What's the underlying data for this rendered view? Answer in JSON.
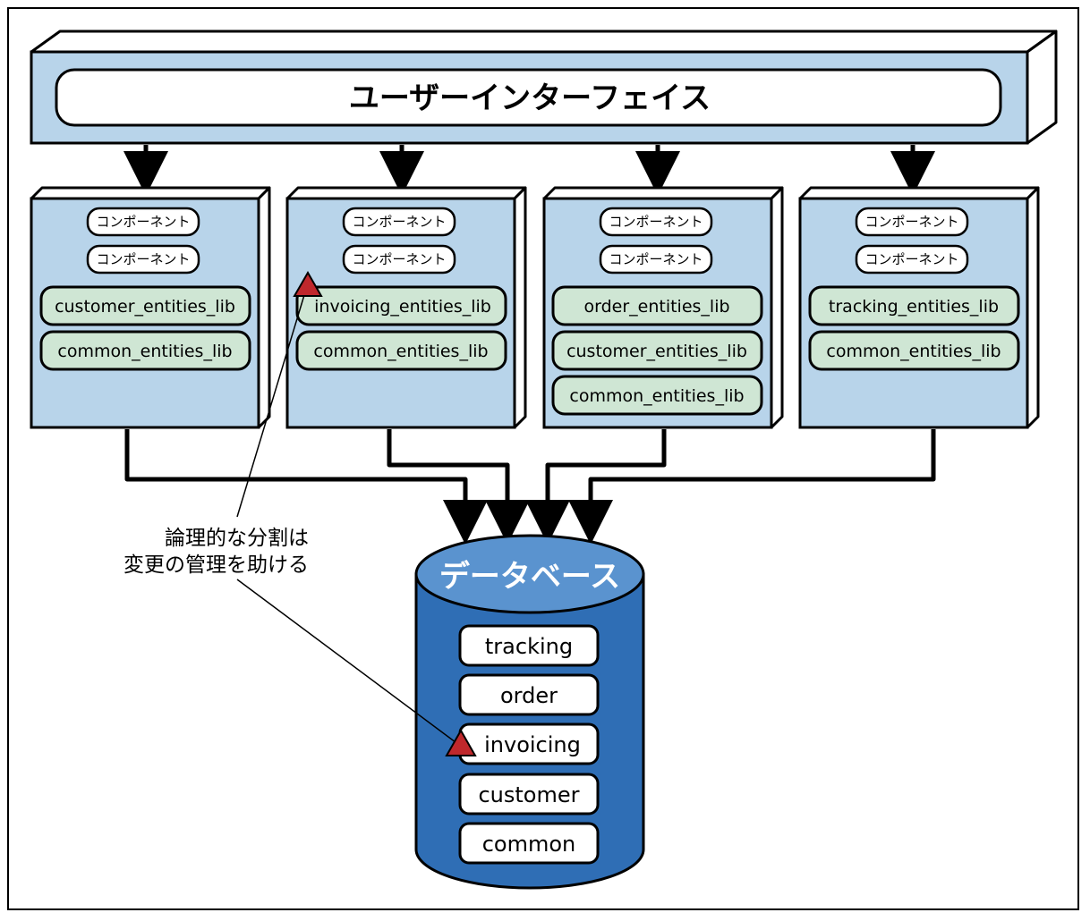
{
  "ui_layer": {
    "title": "ユーザーインターフェイス"
  },
  "colors": {
    "box_fill": "#b8d4ea",
    "lib_fill": "#cfe6d4",
    "db_body": "#2f6eb5",
    "db_top": "#5a93cf",
    "triangle": "#c0282c"
  },
  "services": [
    {
      "components": [
        "コンポーネント",
        "コンポーネント"
      ],
      "libs": [
        "customer_entities_lib",
        "common_entities_lib"
      ]
    },
    {
      "components": [
        "コンポーネント",
        "コンポーネント"
      ],
      "libs": [
        "invoicing_entities_lib",
        "common_entities_lib"
      ]
    },
    {
      "components": [
        "コンポーネント",
        "コンポーネント"
      ],
      "libs": [
        "order_entities_lib",
        "customer_entities_lib",
        "common_entities_lib"
      ]
    },
    {
      "components": [
        "コンポーネント",
        "コンポーネント"
      ],
      "libs": [
        "tracking_entities_lib",
        "common_entities_lib"
      ]
    }
  ],
  "database": {
    "title": "データベース",
    "tables": [
      "tracking",
      "order",
      "invoicing",
      "customer",
      "common"
    ]
  },
  "annotation": {
    "lines": [
      "論理的な分割は",
      "変更の管理を助ける"
    ]
  }
}
